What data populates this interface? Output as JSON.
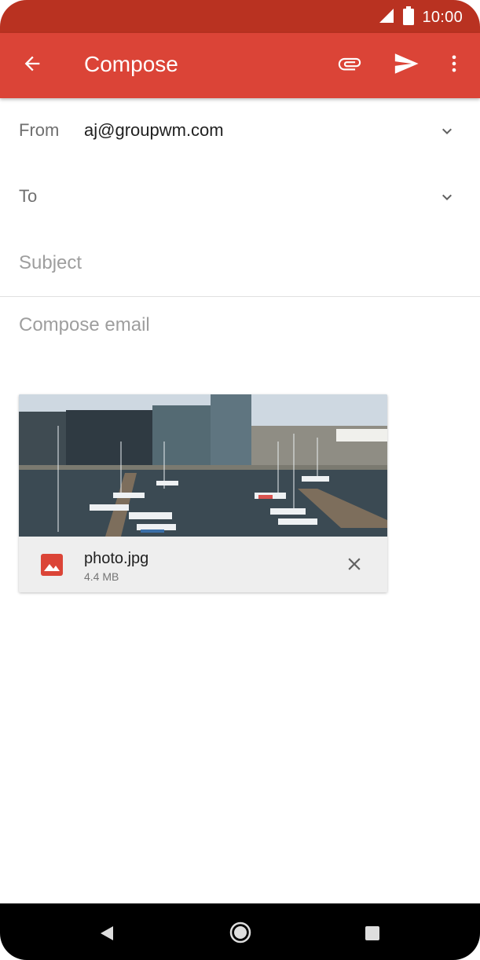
{
  "status_bar": {
    "time": "10:00",
    "icons": [
      "signal-icon",
      "battery-icon"
    ]
  },
  "app_bar": {
    "title": "Compose",
    "icons": [
      "back-arrow-icon",
      "paperclip-icon",
      "send-icon",
      "more-vert-icon"
    ]
  },
  "from": {
    "label": "From",
    "value": "aj@groupwm.com"
  },
  "to": {
    "label": "To",
    "value": ""
  },
  "subject": {
    "placeholder": "Subject"
  },
  "body": {
    "placeholder": "Compose email"
  },
  "attachment": {
    "name": "photo.jpg",
    "size": "4.4 MB",
    "icons": [
      "image-file-icon",
      "close-icon"
    ]
  },
  "colors": {
    "status_bar": "#b93221",
    "app_bar": "#db4437",
    "file_icon": "#db4437",
    "nav_bar": "#000000"
  },
  "nav_bar": {
    "icons": [
      "nav-back-icon",
      "nav-home-icon",
      "nav-recents-icon"
    ]
  }
}
